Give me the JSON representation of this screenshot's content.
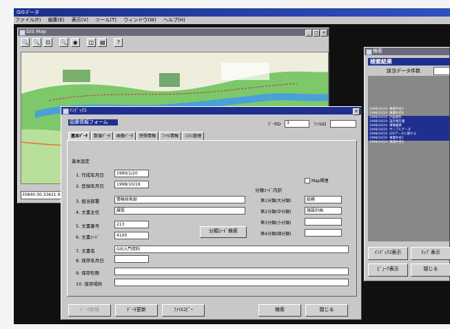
{
  "app": {
    "title": "GISデータ",
    "menu": [
      "ファイル(F)",
      "編集(E)",
      "表示(V)",
      "ツール(T)",
      "ウィンドウ(W)",
      "ヘルプ(H)"
    ]
  },
  "gis_window": {
    "title": "GIS Map",
    "toolbar_icons": [
      "zoom-in-icon",
      "zoom-out-icon",
      "zoom-full-icon",
      "zoom-window-icon",
      "globe-icon",
      "select-icon",
      "print-icon",
      "help-icon"
    ],
    "toolbar_glyphs": [
      "🔍",
      "🔍",
      "⊡",
      "🔍",
      "◉",
      "◫",
      "▤",
      "?"
    ],
    "coordinates": "35840.30,33421.9"
  },
  "search_window": {
    "title": "検索",
    "panel_title": "検索結果",
    "count_label": "該当データ件数",
    "results": [
      {
        "date": "1998/10/19",
        "text": "事業件名A",
        "selected": false
      },
      {
        "date": "1998/10/19",
        "text": "事業件名B",
        "selected": false
      },
      {
        "date": "1998/10/19",
        "text": "計画資料",
        "selected": true
      },
      {
        "date": "1998/10/19",
        "text": "設計報告書",
        "selected": true
      },
      {
        "date": "1998/10/19",
        "text": "事業概要",
        "selected": true
      },
      {
        "date": "1998/10/19",
        "text": "サンプルデータ",
        "selected": true
      },
      {
        "date": "1998/10/19",
        "text": "GISデータに関する",
        "selected": true
      },
      {
        "date": "1998/10/19",
        "text": "事業件名C",
        "selected": true
      },
      {
        "date": "1998/10/19",
        "text": "事業件名D",
        "selected": false
      }
    ],
    "buttons": {
      "index_display": "ｲﾝﾃﾞｯｸｽ表示",
      "map_display": "ﾏｯﾌﾟ表示",
      "viewer_display": "ﾋﾞｭｰｱ表示",
      "close": "閉じる"
    }
  },
  "data_form": {
    "window_title": "ｲﾝﾃﾞｯｸｽ",
    "heading": "図書情報フォーム",
    "data_id_label": "ﾃﾞｰﾀID",
    "data_id_value": "3",
    "file_id_label": "ﾌｧｲﾙID",
    "file_id_value": "",
    "tabs": [
      {
        "label": "基本ﾃﾞｰﾀ",
        "active": true
      },
      {
        "label": "数値ﾃﾞｰﾀ",
        "active": false
      },
      {
        "label": "画像ﾃﾞｰﾀ",
        "active": false
      },
      {
        "label": "特殊情報",
        "active": false
      },
      {
        "label": "ﾌｧｲﾙ情報",
        "active": false
      },
      {
        "label": "ｼｽﾃﾑ管理",
        "active": false
      }
    ],
    "section_title": "基本設定",
    "fields": {
      "created_label": "1. 作成年月日",
      "created_value": "1990/1/20",
      "registered_label": "2. 登録年月日",
      "registered_value": "1998/10/19",
      "dept_label": "3. 担当部署",
      "dept_value": "情報技術部",
      "owner_label": "4. 文書主任",
      "owner_value": "課長",
      "doc_no_label": "5. 文書番号",
      "doc_no_value": "213",
      "doc_code_label": "6. 文書ｺｰﾄﾞ",
      "doc_code_value": "4100",
      "doc_name_label": "7. 文書名",
      "doc_name_value": "GIS入門資料",
      "keep_until_label": "8. 保存年月日",
      "keep_until_value": "",
      "keep_form_label": "9. 保存形態",
      "keep_form_value": "",
      "keep_place_label": "10. 保存場所",
      "keep_place_value": ""
    },
    "map_checkbox_label": "Map関連",
    "classification": {
      "title": "分類ｺｰﾄﾞ内訳",
      "rows": [
        {
          "label": "第1分類(大分類)",
          "value": "総務"
        },
        {
          "label": "第2分類(中分類)",
          "value": "施設計画"
        },
        {
          "label": "第3分類(小分類)",
          "value": ""
        },
        {
          "label": "第4分類(細分類)",
          "value": ""
        }
      ]
    },
    "class_search_button": "分類ｺｰﾄﾞ検索",
    "bottom_buttons": {
      "new": "ﾃﾞｰﾀ新規",
      "update": "ﾃﾞｰﾀ更新",
      "file_copy": "ﾌｧｲﾙｺﾋﾟｰ",
      "search": "検索",
      "close": "閉じる"
    }
  }
}
